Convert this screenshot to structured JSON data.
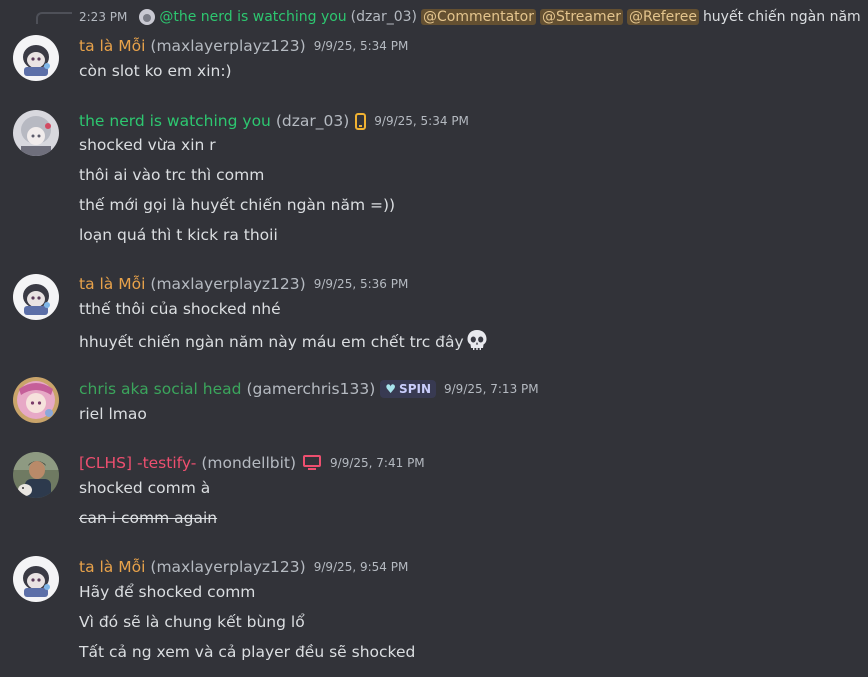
{
  "reply": {
    "time": "2:23 PM",
    "name": "@the nerd is watching you",
    "handle": "(dzar_03)",
    "mentions": [
      "@Commentator",
      "@Streamer",
      "@Referee"
    ],
    "text": "huyết chiến ngàn năm"
  },
  "messages": [
    {
      "name": "ta là Mỗi",
      "handle": "(maxlayerplayz123)",
      "time": "9/9/25, 5:34 PM",
      "lines": [
        "còn slot ko em xin:)"
      ]
    },
    {
      "name": "the nerd is watching you",
      "handle": "(dzar_03)",
      "time": "9/9/25, 5:34 PM",
      "icon": "mobile-phone-icon",
      "lines": [
        "shocked vừa xin r",
        "thôi ai vào trc thì comm",
        "thế mới gọi là huyết chiến ngàn năm =))",
        "loạn quá thì t kick ra thoii"
      ]
    },
    {
      "name": "ta là Mỗi",
      "handle": "(maxlayerplayz123)",
      "time": "9/9/25, 5:36 PM",
      "lines": [
        "tthế thôi của shocked nhé",
        "hhuyết chiến ngàn năm này máu em chết trc đây"
      ],
      "emoji": "skull-emoji"
    },
    {
      "name": "chris aka social head",
      "handle": "(gamerchris133)",
      "badge": "SPIN",
      "badge_icon": "heart-icon",
      "time": "9/9/25, 7:13 PM",
      "lines": [
        "riel lmao"
      ]
    },
    {
      "name": "[CLHS] -testify-",
      "handle": "(mondellbit)",
      "icon": "monitor-icon",
      "time": "9/9/25, 7:41 PM",
      "lines": [
        "shocked comm à",
        "can i comm again"
      ]
    },
    {
      "name": "ta là Mỗi",
      "handle": "(maxlayerplayz123)",
      "time": "9/9/25, 9:54 PM",
      "lines": [
        "Hãy để shocked comm",
        "Vì đó sẽ là chung kết bùng lổ",
        "Tất cả ng xem và cả player đều sẽ shocked"
      ]
    }
  ],
  "colors": {
    "background": "#323339",
    "moi_name": "#e8a24a",
    "nerd_name": "#2dc770",
    "chris_name": "#3ba55c",
    "testify_name": "#ed4f6f",
    "mention_bg": "#5a4d33",
    "text": "#dbdee1",
    "muted": "#b5bac1"
  }
}
